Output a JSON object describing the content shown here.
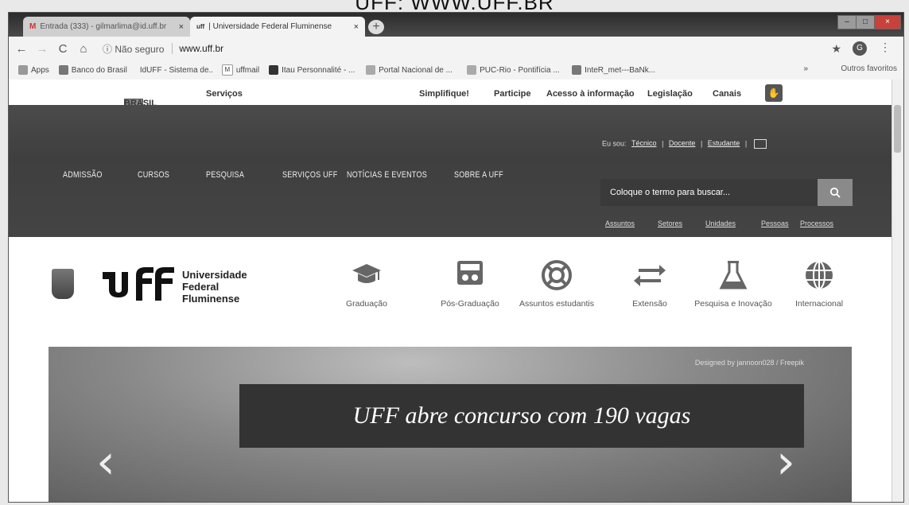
{
  "caption": "UFF: WWW.UFF.BR",
  "browser": {
    "tabs": [
      {
        "icon": "M",
        "title": "Entrada (333) - gilmarlima@id.uff.br"
      },
      {
        "icon": "uff",
        "title": "| Universidade Federal Fluminense"
      }
    ],
    "tab_close": "×",
    "new_tab": "+",
    "window_controls": [
      "–",
      "□",
      "×"
    ],
    "nav": {
      "back": "←",
      "forward": "→",
      "reload": "C",
      "home": "⌂"
    },
    "security_label": "ⓘ Não seguro",
    "url": "www.uff.br",
    "star": "★",
    "profile_initial": "G",
    "menu": "⋮",
    "bookmarks": [
      "Apps",
      "Banco do Brasil",
      "IdUFF - Sistema de...",
      "uffmail",
      "Itau Personnalité - ...",
      "Portal Nacional de ...",
      "PUC-Rio - Pontifícia ...",
      "InteR_met---BaNk..."
    ],
    "bookmarks_more": "»",
    "other_favorites": "Outros favoritos"
  },
  "gov_bar": {
    "brasil": "BRASIL",
    "servicos": "Serviços",
    "links": [
      "Simplifique!",
      "Participe",
      "Acesso à informação",
      "Legislação",
      "Canais"
    ],
    "accessibility": "✋"
  },
  "header": {
    "eu_sou_label": "Eu sou:",
    "eu_sou_links": [
      "Técnico",
      "Docente",
      "Estudante"
    ],
    "nav": [
      "ADMISSÃO",
      "CURSOS",
      "PESQUISA",
      "SERVIÇOS UFF",
      "NOTÍCIAS E EVENTOS",
      "SOBRE A UFF"
    ],
    "search_placeholder": "Coloque o termo para buscar...",
    "search_icon": "🔍",
    "sublinks": [
      "Assuntos",
      "Setores",
      "Unidades",
      "Pessoas",
      "Processos"
    ]
  },
  "brand": {
    "logo_text": "uff",
    "name_lines": [
      "Universidade",
      "Federal",
      "Fluminense"
    ]
  },
  "services": [
    {
      "label": "Graduação",
      "icon": "graduation-cap-icon"
    },
    {
      "label": "Pós-Graduação",
      "icon": "presentation-icon"
    },
    {
      "label": "Assuntos estudantis",
      "icon": "lifebuoy-icon"
    },
    {
      "label": "Extensão",
      "icon": "exchange-arrows-icon"
    },
    {
      "label": "Pesquisa e Inovação",
      "icon": "flask-icon"
    },
    {
      "label": "Internacional",
      "icon": "globe-icon"
    }
  ],
  "banner": {
    "credit": "Designed by jannoon028 / Freepik",
    "title": "UFF abre concurso com 190 vagas",
    "prev": "‹",
    "next": "›"
  },
  "colors": {
    "header_bg": "#444444",
    "banner_title_bg": "#333333"
  }
}
